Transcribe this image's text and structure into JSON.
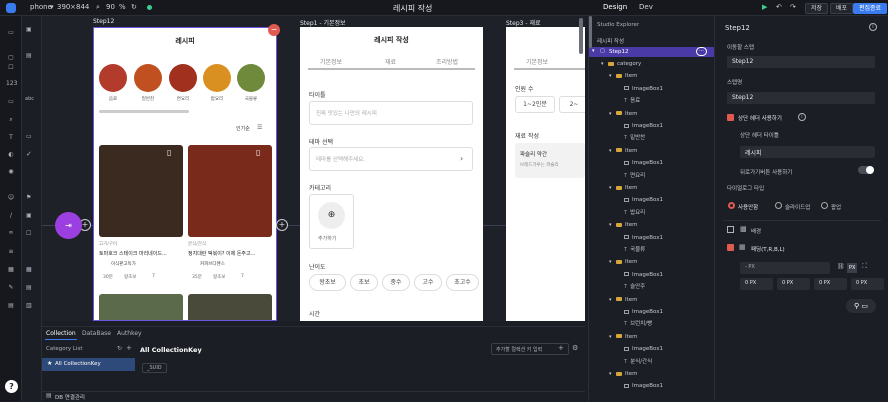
{
  "topbar": {
    "device": "phone",
    "width": "390",
    "height": "844",
    "zoom": "90",
    "zoom_unit": "%",
    "page_title": "레시피 작성",
    "tabs": [
      "Design",
      "Dev"
    ],
    "save_label": "저장",
    "deploy_label": "배포",
    "edit_label": "편집종료"
  },
  "canvas": {
    "frames": [
      {
        "label": "Step12",
        "title": "레시피"
      },
      {
        "label": "Step1 - 기본정보",
        "title": "레시피 작성"
      },
      {
        "label": "Step3 - 재료",
        "title": ""
      }
    ],
    "step12": {
      "categories": [
        "음료",
        "밑반찬",
        "면요리",
        "밥요리",
        "국물류"
      ],
      "sort_label": "인기순",
      "cards": [
        {
          "category": "고기/구이",
          "title": "토마호크 스테이크 마리네이드...",
          "author": "이식판고독가",
          "time": "30분",
          "level": "왕초보",
          "views": "7"
        },
        {
          "category": "분식/간식",
          "title": "정지대란 떡볶이? 이제 돈주고...",
          "author": "커피브다펜스",
          "time": "35분",
          "level": "왕초보",
          "views": "7"
        }
      ]
    },
    "step1": {
      "tabs": [
        "기본정보",
        "재료",
        "조리방법"
      ],
      "title_label": "타이틀",
      "title_placeholder": "진짜 맛있는 나만의 레시피",
      "theme_label": "테마 선택",
      "theme_placeholder": "테마를 선택해주세요.",
      "category_label": "카테고리",
      "add_label": "추가하기",
      "difficulty_label": "난이도",
      "difficulties": [
        "왕초보",
        "초보",
        "중수",
        "고수",
        "초고수"
      ],
      "time_label": "시간"
    },
    "step3": {
      "tab": "기본정보",
      "servings_label": "인원 수",
      "servings": [
        "1~2인분",
        "2~"
      ],
      "ingredients_label": "재료 작성",
      "ingredient_name": "파슬리 약간",
      "ingredient_hint": "브레드가루는 파슬리"
    }
  },
  "bottom": {
    "tabs": [
      "Collection",
      "DataBase",
      "Authkey"
    ],
    "category_list": "Category List",
    "all_collection": "All CollectionKey",
    "heading": "All CollectionKey",
    "placeholder": "추가할 컬렉션 키 입력",
    "suid": "_SUID",
    "db_connect": "DB 연결관리"
  },
  "tree": {
    "explorer": "Studio Explorer",
    "root": "레시피 작성",
    "selected": "Step12",
    "rows": [
      {
        "type": "folder",
        "label": "category",
        "indent": 1
      },
      {
        "type": "folder",
        "label": "Item",
        "indent": 2
      },
      {
        "type": "image",
        "label": "ImageBox1",
        "indent": 3
      },
      {
        "type": "text",
        "label": "음료",
        "indent": 3
      },
      {
        "type": "folder",
        "label": "Item",
        "indent": 2
      },
      {
        "type": "image",
        "label": "ImageBox1",
        "indent": 3
      },
      {
        "type": "text",
        "label": "밑반찬",
        "indent": 3
      },
      {
        "type": "folder",
        "label": "Item",
        "indent": 2
      },
      {
        "type": "image",
        "label": "ImageBox1",
        "indent": 3
      },
      {
        "type": "text",
        "label": "면요리",
        "indent": 3
      },
      {
        "type": "folder",
        "label": "Item",
        "indent": 2
      },
      {
        "type": "image",
        "label": "ImageBox1",
        "indent": 3
      },
      {
        "type": "text",
        "label": "밥요리",
        "indent": 3
      },
      {
        "type": "folder",
        "label": "Item",
        "indent": 2
      },
      {
        "type": "image",
        "label": "ImageBox1",
        "indent": 3
      },
      {
        "type": "text",
        "label": "국물류",
        "indent": 3
      },
      {
        "type": "folder",
        "label": "Item",
        "indent": 2
      },
      {
        "type": "image",
        "label": "ImageBox1",
        "indent": 3
      },
      {
        "type": "text",
        "label": "술안주",
        "indent": 3
      },
      {
        "type": "folder",
        "label": "Item",
        "indent": 2
      },
      {
        "type": "image",
        "label": "ImageBox1",
        "indent": 3
      },
      {
        "type": "text",
        "label": "브런치/빵",
        "indent": 3
      },
      {
        "type": "folder",
        "label": "Item",
        "indent": 2
      },
      {
        "type": "image",
        "label": "ImageBox1",
        "indent": 3
      },
      {
        "type": "text",
        "label": "분식/간식",
        "indent": 3
      },
      {
        "type": "folder",
        "label": "Item",
        "indent": 2
      },
      {
        "type": "image",
        "label": "ImageBox1",
        "indent": 3
      }
    ]
  },
  "props": {
    "title": "Step12",
    "move_label": "이동할 스텝",
    "move_value": "Step12",
    "step_name_label": "스텝명",
    "step_name_value": "Step12",
    "use_header_label": "상단 헤더 사용하기",
    "header_title_label": "상단 헤더 타이틀",
    "header_title_value": "레시피",
    "back_button_label": "뒤로가기버튼 사용하기",
    "dialog_type_label": "다이얼로그 타입",
    "dialog_types": [
      "사용안함",
      "슬라이드업",
      "팝업"
    ],
    "background_label": "배경",
    "padding_label": "패딩(T,R,B,L)",
    "px_placeholder": "- PX",
    "px_unit": "PX",
    "padding_values": [
      "0",
      "0",
      "0",
      "0"
    ]
  },
  "colors": {
    "accent": "#3a7bf0",
    "selected": "#5b3fd6",
    "purple_fab": "#9b3fe0",
    "checkbox": "#e05a4f"
  }
}
